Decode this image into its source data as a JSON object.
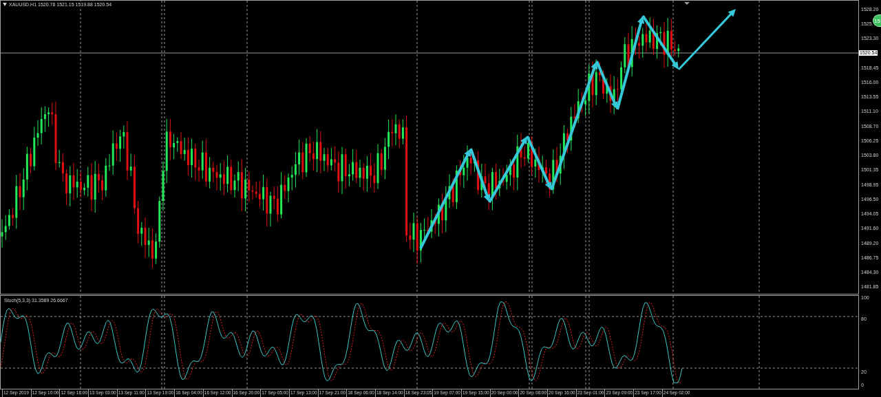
{
  "chart_header": {
    "title": "XAUUSD.H1 1520.78 1521.15 1519.88 1520.54"
  },
  "price_axis": [
    {
      "kind": "tick",
      "label": "1528.20"
    },
    {
      "kind": "tick",
      "label": "1525."
    },
    {
      "kind": "tick",
      "label": "1523.30"
    },
    {
      "kind": "current",
      "label": "1520.54"
    },
    {
      "kind": "tick",
      "label": "1518.45"
    },
    {
      "kind": "tick",
      "label": "1516.00"
    },
    {
      "kind": "tick",
      "label": "1513.55"
    },
    {
      "kind": "tick",
      "label": "1511.10"
    },
    {
      "kind": "tick",
      "label": "1508.70"
    },
    {
      "kind": "tick",
      "label": "1506.25"
    },
    {
      "kind": "tick",
      "label": "1503.80"
    },
    {
      "kind": "tick",
      "label": "1501.35"
    },
    {
      "kind": "tick",
      "label": "1498.95"
    },
    {
      "kind": "tick",
      "label": "1496.50"
    },
    {
      "kind": "tick",
      "label": "1494.05"
    },
    {
      "kind": "tick",
      "label": "1491.60"
    },
    {
      "kind": "tick",
      "label": "1489.20"
    },
    {
      "kind": "tick",
      "label": "1486.75"
    },
    {
      "kind": "tick",
      "label": "1484.30"
    },
    {
      "kind": "tick",
      "label": "1481.85"
    }
  ],
  "trade_badge": {
    "label": "15"
  },
  "indicator": {
    "title": "Stoch(5,3,3) 31.3589 26.6667",
    "axis": [
      "100",
      "80",
      "20",
      "0"
    ]
  },
  "time_axis": [
    "12 Sep 2019",
    "12 Sep 10:00",
    "12 Sep 18:00",
    "13 Sep 03:00",
    "13 Sep 11:00",
    "13 Sep 19:00",
    "16 Sep 04:00",
    "16 Sep 12:00",
    "16 Sep 20:00",
    "17 Sep 05:00",
    "17 Sep 13:00",
    "17 Sep 21:00",
    "18 Sep 06:00",
    "18 Sep 14:00",
    "18 Sep 23:05",
    "19 Sep 07:00",
    "19 Sep 15:00",
    "20 Sep 00:00",
    "20 Sep 08:00",
    "20 Sep 16:00",
    "23 Sep 01:00",
    "23 Sep 09:00",
    "23 Sep 17:00",
    "24 Sep 02:00"
  ]
}
